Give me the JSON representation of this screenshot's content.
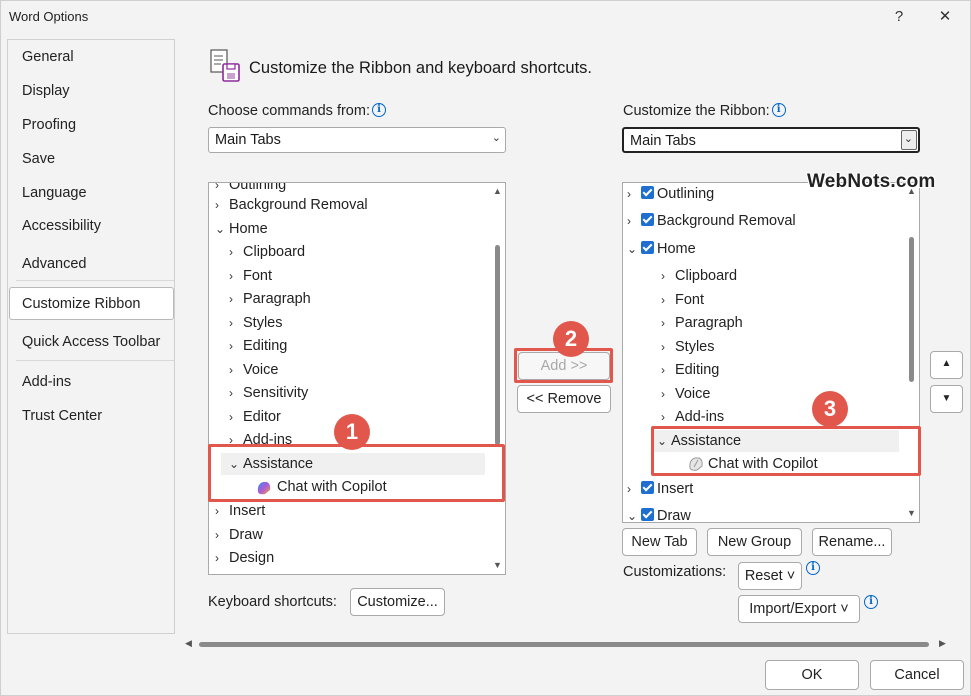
{
  "window": {
    "title": "Word Options",
    "help": "?",
    "close": "✕"
  },
  "nav": {
    "items": [
      "General",
      "Display",
      "Proofing",
      "Save",
      "Language",
      "Accessibility",
      "Advanced",
      "Customize Ribbon",
      "Quick Access Toolbar",
      "Add-ins",
      "Trust Center"
    ],
    "selected": "Customize Ribbon"
  },
  "header": {
    "title": "Customize the Ribbon and keyboard shortcuts."
  },
  "left": {
    "label": "Choose commands from:",
    "combo": "Main Tabs",
    "list": [
      "Outlining",
      "Background Removal",
      "Home",
      "Clipboard",
      "Font",
      "Paragraph",
      "Styles",
      "Editing",
      "Voice",
      "Sensitivity",
      "Editor",
      "Add-ins",
      "Assistance",
      "Chat with Copilot",
      "Insert",
      "Draw",
      "Design"
    ]
  },
  "right": {
    "label": "Customize the Ribbon:",
    "combo": "Main Tabs",
    "list": [
      "Outlining",
      "Background Removal",
      "Home",
      "Clipboard",
      "Font",
      "Paragraph",
      "Styles",
      "Editing",
      "Voice",
      "Add-ins",
      "Assistance",
      "Chat with Copilot",
      "Insert",
      "Draw"
    ]
  },
  "middle": {
    "add": "Add >>",
    "remove": "<< Remove"
  },
  "bottom": {
    "new_tab": "New Tab",
    "new_group": "New Group",
    "rename": "Rename...",
    "customizations": "Customizations:",
    "reset": "Reset ˅",
    "import_export": "Import/Export ˅",
    "keyboard_shortcuts": "Keyboard shortcuts:",
    "customize": "Customize...",
    "ok": "OK",
    "cancel": "Cancel"
  },
  "badges": [
    "1",
    "2",
    "3"
  ],
  "watermark": "WebNots.com",
  "colors": {
    "accent": "#1f6fd1",
    "highlight": "#e2574c"
  }
}
